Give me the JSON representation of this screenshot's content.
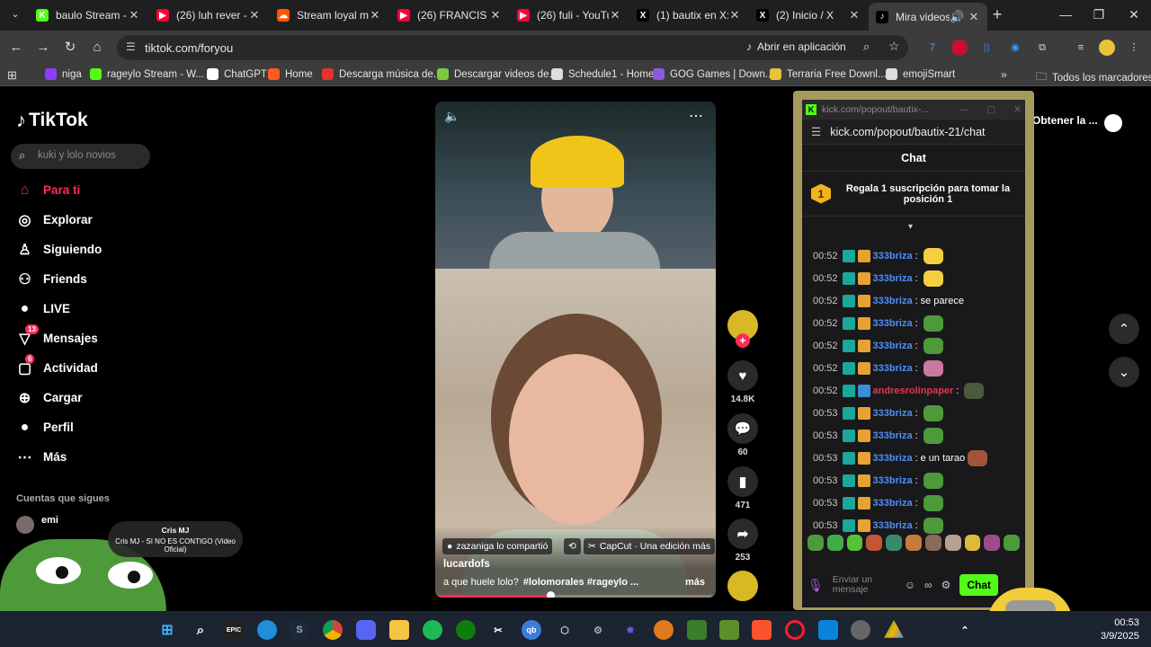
{
  "browser": {
    "tabs": [
      {
        "title": "baulo Stream - W",
        "fav_color": "#53fc18",
        "fav_glyph": "K"
      },
      {
        "title": "(26) luh rever - u",
        "fav_color": "#ff0033",
        "fav_glyph": "▶"
      },
      {
        "title": "Stream loyal mu",
        "fav_color": "#ff5500",
        "fav_glyph": "☁"
      },
      {
        "title": "(26) FRANCIS JE",
        "fav_color": "#ff0033",
        "fav_glyph": "▶"
      },
      {
        "title": "(26) fuli - YouTu",
        "fav_color": "#ff0033",
        "fav_glyph": "▶"
      },
      {
        "title": "(1) bautix en X:",
        "fav_color": "#000000",
        "fav_glyph": "X"
      },
      {
        "title": "(2) Inicio / X",
        "fav_color": "#000000",
        "fav_glyph": "X"
      },
      {
        "title": "Mira videos",
        "fav_color": "#000000",
        "fav_glyph": "♪"
      }
    ],
    "url": "tiktok.com/foryou",
    "open_in_app": "Abrir en aplicación",
    "bookmarks": [
      {
        "label": "niga",
        "color": "#8a3ffc"
      },
      {
        "label": "rageylo Stream - W...",
        "color": "#53fc18"
      },
      {
        "label": "ChatGPT",
        "color": "#ffffff"
      },
      {
        "label": "Home",
        "color": "#ff5a1f"
      },
      {
        "label": "Descarga música de...",
        "color": "#e5322d"
      },
      {
        "label": "Descargar videos de...",
        "color": "#7ac943"
      },
      {
        "label": "Schedule1 - Home",
        "color": "#dddddd"
      },
      {
        "label": "GOG Games | Down...",
        "color": "#8c5ae0"
      },
      {
        "label": "Terraria Free Downl...",
        "color": "#e8c33a"
      },
      {
        "label": "emojiSmart",
        "color": "#dddddd"
      }
    ],
    "all_bookmarks": "Todos los marcadores"
  },
  "tiktok": {
    "logo": "TikTok",
    "search_placeholder": "kuki y lolo novios",
    "nav": [
      {
        "label": "Para ti",
        "icon": "home-icon",
        "active": true
      },
      {
        "label": "Explorar",
        "icon": "compass-icon"
      },
      {
        "label": "Siguiendo",
        "icon": "person-icon"
      },
      {
        "label": "Friends",
        "icon": "friends-icon"
      },
      {
        "label": "LIVE",
        "icon": "live-icon"
      },
      {
        "label": "Mensajes",
        "icon": "message-icon",
        "badge": "13"
      },
      {
        "label": "Actividad",
        "icon": "activity-icon",
        "badge": "6"
      },
      {
        "label": "Cargar",
        "icon": "upload-icon"
      },
      {
        "label": "Perfil",
        "icon": "profile-icon"
      },
      {
        "label": "Más",
        "icon": "more-icon"
      }
    ],
    "following_title": "Cuentas que sigues",
    "video": {
      "shared_by": "zazaniga lo compartió",
      "capcut": "CapCut · Una edición más",
      "author": "lucardofs",
      "caption": "a que huele lolo?",
      "hashtags": "#lolomorales #rageylo ...",
      "more": "más",
      "progress": 0.41
    },
    "actions": {
      "likes": "14.8K",
      "comments": "60",
      "saves": "471",
      "shares": "253"
    },
    "obtener": "Obtener la ..."
  },
  "kick": {
    "window_title": "kick.com/popout/bautix-...",
    "url": "kick.com/popout/bautix-21/chat",
    "chat_title": "Chat",
    "gift_text": "Regala 1 suscripción para tomar la posición 1",
    "gift_rank": "1",
    "messages": [
      {
        "time": "00:52",
        "user": "333briza",
        "text": "",
        "color": "#4f8ef7",
        "emote": "#f4d03f"
      },
      {
        "time": "00:52",
        "user": "333briza",
        "text": "",
        "color": "#4f8ef7",
        "emote": "#f4d03f"
      },
      {
        "time": "00:52",
        "user": "333briza",
        "text": "se parece",
        "color": "#4f8ef7",
        "emote": ""
      },
      {
        "time": "00:52",
        "user": "333briza",
        "text": "",
        "color": "#4f8ef7",
        "emote": "#4c9a3a"
      },
      {
        "time": "00:52",
        "user": "333briza",
        "text": "",
        "color": "#4f8ef7",
        "emote": "#4c9a3a"
      },
      {
        "time": "00:52",
        "user": "333briza",
        "text": "",
        "color": "#4f8ef7",
        "emote": "#c77aa0"
      },
      {
        "time": "00:52",
        "user": "andresrolinpaper",
        "text": "",
        "color": "#e8334a",
        "emote": "#4a5a3a"
      },
      {
        "time": "00:53",
        "user": "333briza",
        "text": "",
        "color": "#4f8ef7",
        "emote": "#4c9a3a"
      },
      {
        "time": "00:53",
        "user": "333briza",
        "text": "",
        "color": "#4f8ef7",
        "emote": "#4c9a3a"
      },
      {
        "time": "00:53",
        "user": "333briza",
        "text": "e un tarao",
        "color": "#4f8ef7",
        "emote": "#a0553a"
      },
      {
        "time": "00:53",
        "user": "333briza",
        "text": "",
        "color": "#4f8ef7",
        "emote": "#4c9a3a"
      },
      {
        "time": "00:53",
        "user": "333briza",
        "text": "",
        "color": "#4f8ef7",
        "emote": "#4c9a3a"
      },
      {
        "time": "00:53",
        "user": "333briza",
        "text": "",
        "color": "#4f8ef7",
        "emote": "#4c9a3a"
      }
    ],
    "input_placeholder": "Enviar un mensaje",
    "send_label": "Chat"
  },
  "notification": {
    "artist": "Cris MJ",
    "song": "Cris MJ - SI NO ES CONTIGO (Video Oficial)"
  },
  "clock": {
    "time": "00:53",
    "date": "3/9/2025"
  }
}
